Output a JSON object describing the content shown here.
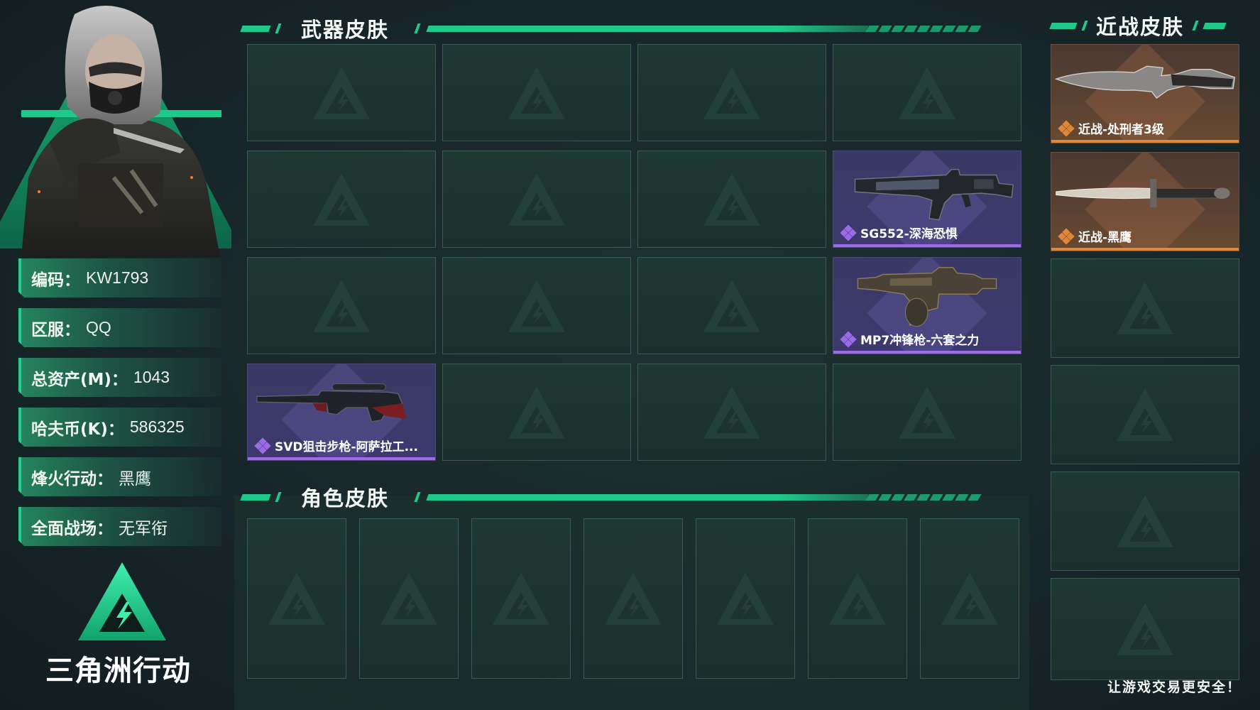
{
  "profile": {
    "fields": [
      {
        "label": "编码",
        "value": "KW1793"
      },
      {
        "label": "区服",
        "value": "QQ"
      },
      {
        "label": "总资产(M)",
        "value": "1043"
      },
      {
        "label": "哈夫币(K)",
        "value": "586325"
      },
      {
        "label": "烽火行动",
        "value": "黑鹰"
      },
      {
        "label": "全面战场",
        "value": "无军衔"
      }
    ]
  },
  "brand": {
    "name": "三角洲行动",
    "logo_icon": "delta-force-logo-icon"
  },
  "sections": {
    "weapon_skins": {
      "title": "武器皮肤"
    },
    "melee_skins": {
      "title": "近战皮肤"
    },
    "character_skins": {
      "title": "角色皮肤"
    }
  },
  "weapon_items": [
    {
      "name": "SG552-深海恐惧",
      "rarity": "purple",
      "icon": "assault-rifle-icon"
    },
    {
      "name": "MP7冲锋枪-六套之力",
      "rarity": "purple",
      "icon": "smg-icon"
    },
    {
      "name": "SVD狙击步枪-阿萨拉工...",
      "rarity": "purple",
      "icon": "sniper-rifle-icon"
    }
  ],
  "melee_items": [
    {
      "name": "近战-处刑者3级",
      "rarity": "orange",
      "icon": "combat-knife-icon"
    },
    {
      "name": "近战-黑鹰",
      "rarity": "orange",
      "icon": "dagger-icon"
    }
  ],
  "footer": {
    "slogan": "让游戏交易更安全！"
  },
  "colors": {
    "accent": "#1fc98a",
    "purple_rarity": "#9b6ce6",
    "orange_rarity": "#e0873a"
  }
}
